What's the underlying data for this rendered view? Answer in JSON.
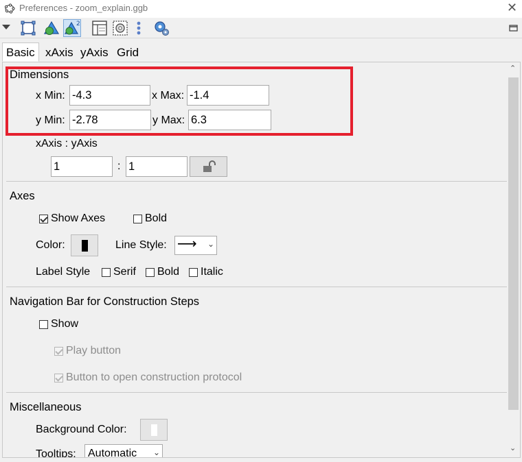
{
  "window": {
    "title": "Preferences - zoom_explain.ggb"
  },
  "tabs": [
    "Basic",
    "xAxis",
    "yAxis",
    "Grid"
  ],
  "dimensions": {
    "heading": "Dimensions",
    "xmin_label": "x Min:",
    "xmin_value": "-4.3",
    "xmax_label": "x Max:",
    "xmax_value": "-1.4",
    "ymin_label": "y Min:",
    "ymin_value": "-2.78",
    "ymax_label": "y Max:",
    "ymax_value": "6.3",
    "ratio_label": "xAxis : yAxis",
    "ratio_x": "1",
    "ratio_sep": ":",
    "ratio_y": "1"
  },
  "axes": {
    "heading": "Axes",
    "show_axes_label": "Show Axes",
    "show_axes_checked": true,
    "bold_label": "Bold",
    "bold_checked": false,
    "color_label": "Color:",
    "color_value": "#000000",
    "line_style_label": "Line Style:",
    "line_style_value": "⟶",
    "label_style_label": "Label Style",
    "serif_label": "Serif",
    "label_bold_label": "Bold",
    "italic_label": "Italic"
  },
  "navigation": {
    "heading": "Navigation Bar for Construction Steps",
    "show_label": "Show",
    "play_button_label": "Play button",
    "protocol_button_label": "Button to open construction protocol"
  },
  "misc": {
    "heading": "Miscellaneous",
    "background_color_label": "Background Color:",
    "background_color_value": "#ffffff",
    "tooltips_label": "Tooltips:",
    "tooltips_value": "Automatic"
  },
  "colors": {
    "highlight": "#e5202e"
  }
}
